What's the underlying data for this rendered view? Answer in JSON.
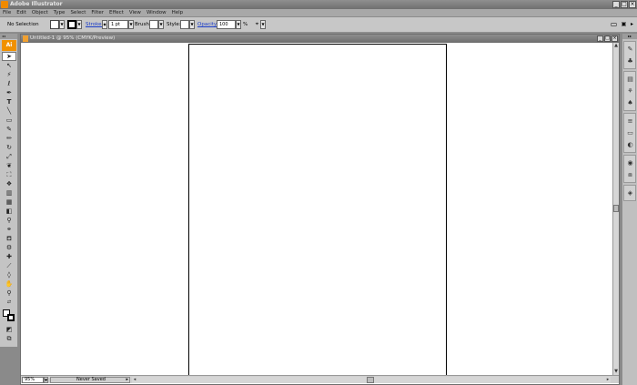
{
  "window": {
    "title": "Adobe Illustrator",
    "controls": [
      "_",
      "□",
      "×"
    ]
  },
  "menu": [
    "File",
    "Edit",
    "Object",
    "Type",
    "Select",
    "Filter",
    "Effect",
    "View",
    "Window",
    "Help"
  ],
  "control_bar": {
    "selection_label": "No Selection",
    "stroke_label": "Stroke:",
    "stroke_value": "1 pt",
    "brush_label": "Brush:",
    "style_label": "Style:",
    "opacity_label": "Opacity:",
    "opacity_value": "100",
    "percent": "%"
  },
  "tools": {
    "logo": "Ai",
    "items": [
      "selection-tool",
      "direct-selection-tool",
      "magic-wand-tool",
      "lasso-tool",
      "pen-tool",
      "type-tool",
      "line-tool",
      "rectangle-tool",
      "paintbrush-tool",
      "pencil-tool",
      "rotate-tool",
      "scale-tool",
      "warp-tool",
      "free-transform-tool",
      "symbol-sprayer-tool",
      "column-graph-tool",
      "mesh-tool",
      "gradient-tool",
      "eyedropper-tool",
      "blend-tool",
      "live-paint-tool",
      "live-paint-selection-tool",
      "crop-area-tool",
      "slice-tool",
      "eraser-tool",
      "hand-tool",
      "zoom-tool"
    ]
  },
  "document": {
    "title": "Untitled-1 @ 95% (CMYK/Preview)",
    "zoom": "95%",
    "status": "Never Saved"
  },
  "right_panels": [
    "brushes-icon",
    "symbols-icon",
    "graphic-styles-icon",
    "swatches-icon",
    "color-icon",
    "stroke-icon",
    "gradient-icon",
    "transparency-icon",
    "appearance-icon",
    "navigator-icon",
    "layers-icon"
  ]
}
